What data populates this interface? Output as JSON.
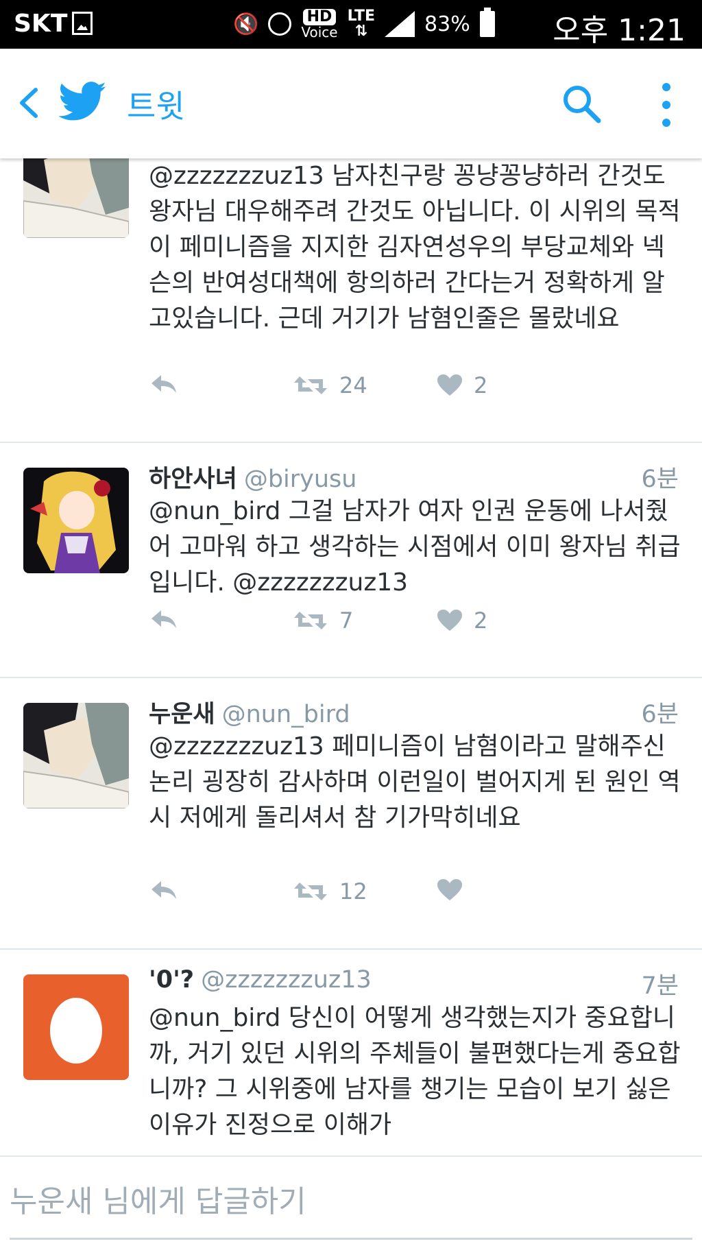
{
  "status_bar": {
    "carrier": "SKT",
    "hd_label": "HD",
    "voice_label": "Voice",
    "network": "LTE",
    "battery": "83%",
    "time": "오후 1:21"
  },
  "header": {
    "title": "트윗",
    "accent_color": "#1da1f2"
  },
  "tweets": [
    {
      "name": "",
      "handle": "",
      "time": "",
      "mention": "@zzzzzzzuz13",
      "text": " 남자친구랑 꽁냥꽁냥하러 간것도 왕자님 대우해주려 간것도 아닙니다. 이 시위의 목적이 페미니즘을 지지한 김자연성우의 부당교체와 넥슨의 반여성대책에 항의하러 간다는거 정확하게 알고있습니다. 근데 거기가 남혐인줄은 몰랐네요",
      "retweets": "24",
      "likes": "2",
      "avatar_icon": "manga-avatar-icon"
    },
    {
      "name": "하안사녀",
      "handle": "@biryusu",
      "time": "6분",
      "mention": "@nun_bird",
      "text": " 그걸 남자가 여자 인권 운동에 나서줬어 고마워 하고 생각하는 시점에서 이미 왕자님 취급입니다. @zzzzzzzuz13",
      "retweets": "7",
      "likes": "2",
      "avatar_icon": "anime-girl-avatar-icon"
    },
    {
      "name": "누운새",
      "handle": "@nun_bird",
      "time": "6분",
      "mention": "@zzzzzzzuz13",
      "text": " 페미니즘이 남혐이라고 말해주신 논리 굉장히 감사하며 이런일이 벌어지게 된 원인 역시 저에게 돌리셔서 참 기가막히네요",
      "retweets": "12",
      "likes": "",
      "avatar_icon": "manga-avatar-icon"
    },
    {
      "name": "'0'?",
      "handle": "@zzzzzzzuz13",
      "time": "7분",
      "mention": "@nun_bird",
      "text": " 당신이 어떻게 생각했는지가 중요합니까, 거기 있던 시위의 주체들이 불편했다는게 중요합니까? 그 시위중에 남자를 챙기는 모습이 보기 싫은 이유가 진정으로 이해가",
      "retweets": "",
      "likes": "",
      "avatar_icon": "egg-avatar-icon",
      "avatar_color": "#e8612c"
    }
  ],
  "reply": {
    "placeholder": "누운새 님에게 답글하기"
  }
}
